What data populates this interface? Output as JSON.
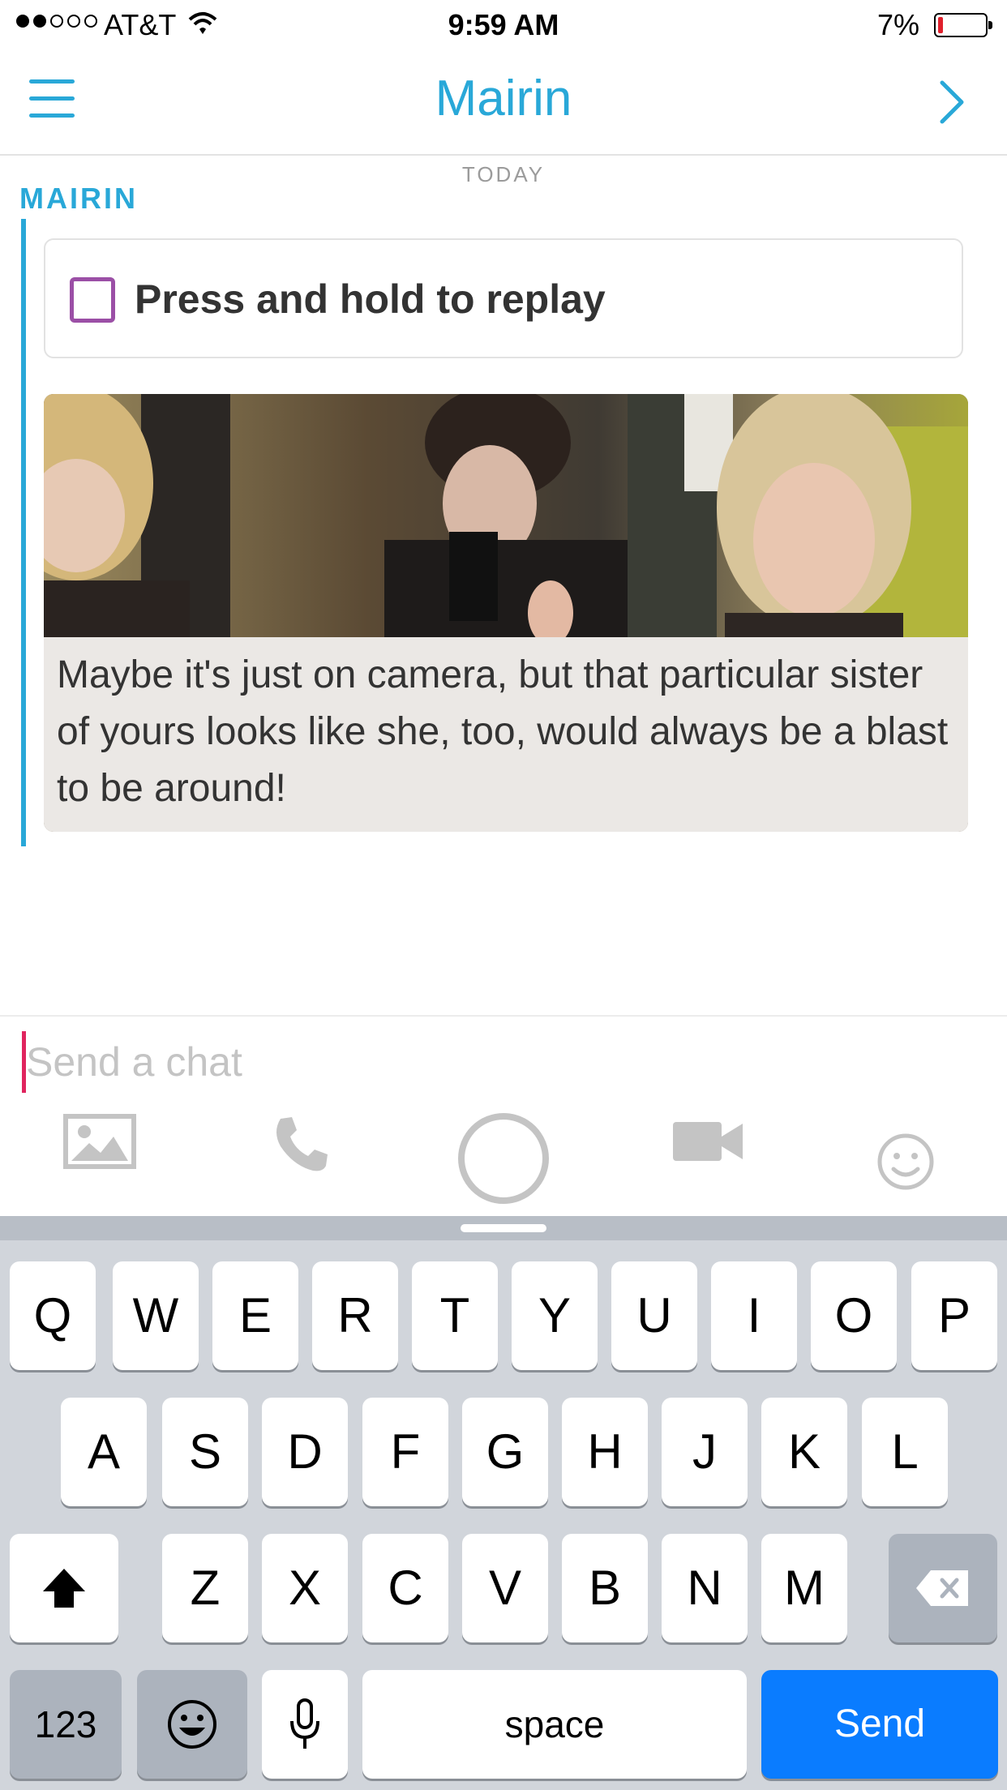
{
  "status_bar": {
    "carrier": "AT&T",
    "time": "9:59 AM",
    "battery_percent": "7%",
    "battery_level": 0.07,
    "signal_bars_filled": 2,
    "signal_bars_total": 5
  },
  "nav": {
    "title": "Mairin",
    "left_icon": "menu-icon",
    "right_icon": "chevron-right-icon"
  },
  "chat": {
    "date_header": "TODAY",
    "sender": "MAIRIN",
    "replay_hint": "Press and hold to replay",
    "media_caption": "Maybe it's just on camera, but that particular sister of yours looks like she, too, would always be a blast to be around!"
  },
  "input": {
    "placeholder": "Send a chat",
    "value": ""
  },
  "toolbar": {
    "icons": [
      "image-icon",
      "phone-icon",
      "camera-shutter-icon",
      "video-icon",
      "smiley-icon"
    ]
  },
  "keyboard": {
    "row1": [
      "Q",
      "W",
      "E",
      "R",
      "T",
      "Y",
      "U",
      "I",
      "O",
      "P"
    ],
    "row2": [
      "A",
      "S",
      "D",
      "F",
      "G",
      "H",
      "J",
      "K",
      "L"
    ],
    "row3": [
      "Z",
      "X",
      "C",
      "V",
      "B",
      "N",
      "M"
    ],
    "numbers_key": "123",
    "space_key": "space",
    "send_key": "Send",
    "shift_icon": "shift-icon",
    "delete_icon": "backspace-icon",
    "emoji_icon": "emoji-icon",
    "mic_icon": "microphone-icon"
  },
  "colors": {
    "accent": "#29a8d8",
    "checkbox": "#9b4fa6",
    "cursor": "#e0245e",
    "send_key": "#0a7cff",
    "battery_low": "#e0202c"
  }
}
